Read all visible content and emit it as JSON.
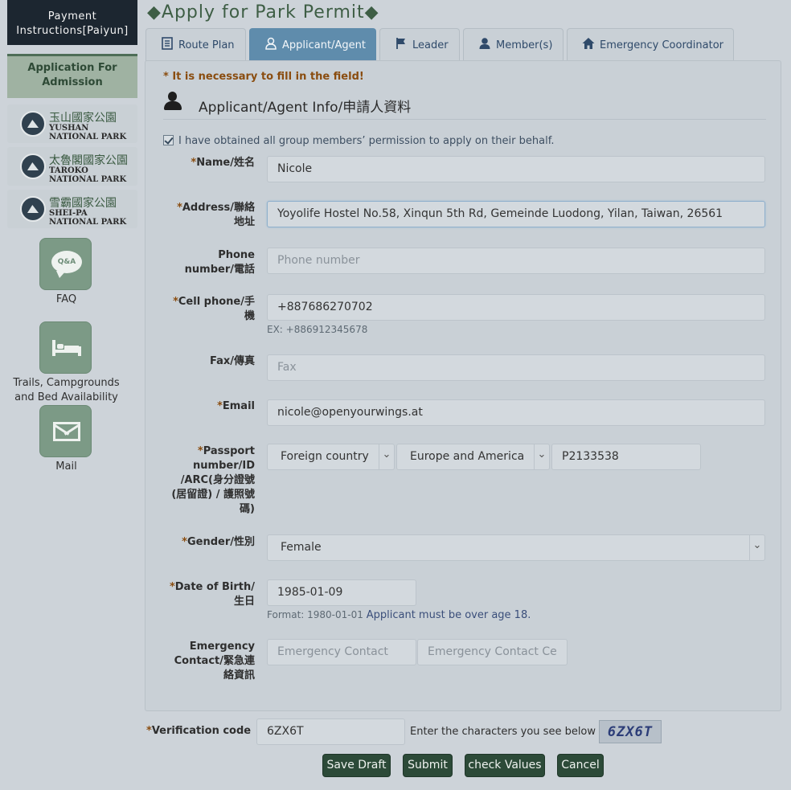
{
  "sidebar": {
    "payment_line1": "Payment",
    "payment_line2": "Instructions[Paiyun]",
    "admission_line1": "Application For",
    "admission_line2": "Admission",
    "parks": [
      {
        "zh": "玉山國家公園",
        "en1": "YUSHAN",
        "en2": "NATIONAL PARK"
      },
      {
        "zh": "太魯閣國家公園",
        "en1": "TAROKO",
        "en2": "NATIONAL PARK"
      },
      {
        "zh": "雪霸國家公園",
        "en1": "SHEI-PA",
        "en2": "NATIONAL PARK"
      }
    ],
    "faq_icon_text": "Q&A",
    "faq_label": "FAQ",
    "trails_line1": "Trails, Campgrounds",
    "trails_line2": "and Bed Availability",
    "mail_label": "Mail"
  },
  "page": {
    "title": "◆Apply for Park Permit◆"
  },
  "tabs": [
    {
      "label": "Route Plan",
      "icon": "list-icon"
    },
    {
      "label": "Applicant/Agent",
      "icon": "user-icon",
      "active": true
    },
    {
      "label": "Leader",
      "icon": "flag-icon"
    },
    {
      "label": "Member(s)",
      "icon": "user-icon"
    },
    {
      "label": "Emergency Coordinator",
      "icon": "home-icon"
    }
  ],
  "form": {
    "required_note": "* It is necessary to fill in the field!",
    "section_title": "Applicant/Agent Info/申請人資料",
    "consent": "I have obtained all group members’ permission to apply on their behalf.",
    "asterisk": "*",
    "name": {
      "label": "Name/姓名",
      "value": "Nicole"
    },
    "address": {
      "label1": "Address/聯絡",
      "label2": "地址",
      "value": "Yoyolife Hostel No.58, Xinqun 5th Rd, Gemeinde Luodong, Yilan, Taiwan, 26561"
    },
    "phone": {
      "label1": "Phone",
      "label2": "number/電話",
      "placeholder": "Phone number"
    },
    "cell": {
      "label1": "Cell phone/手",
      "label2": "機",
      "value": "+887686270702",
      "hint": "EX: +886912345678"
    },
    "fax": {
      "label": "Fax/傳真",
      "placeholder": "Fax"
    },
    "email": {
      "label": "Email",
      "value": "nicole@openyourwings.at"
    },
    "passport": {
      "label1": "Passport",
      "label2": "number/ID",
      "label3": "/ARC(身分證號",
      "label4": "(居留證) / 護照號",
      "label5": "碼)",
      "country": "Foreign country",
      "region": "Europe and America",
      "value": "P2133538"
    },
    "gender": {
      "label": "Gender/性別",
      "value": "Female"
    },
    "dob": {
      "label1": "Date of Birth/",
      "label2": "生日",
      "value": "1985-01-09",
      "format": "Format:  1980-01-01",
      "age_note": "Applicant must be over age 18."
    },
    "emergency": {
      "label1": "Emergency",
      "label2": "Contact/緊急連",
      "label3": "絡資訊",
      "ph1": "Emergency Contact",
      "ph2": "Emergency Contact Ce"
    }
  },
  "verify": {
    "label": "Verification code",
    "value": "6ZX6T",
    "note": "Enter the characters you see below",
    "captcha": "6ZX6T"
  },
  "buttons": {
    "save_draft": "Save Draft",
    "submit": "Submit",
    "check": "check Values",
    "cancel": "Cancel"
  }
}
